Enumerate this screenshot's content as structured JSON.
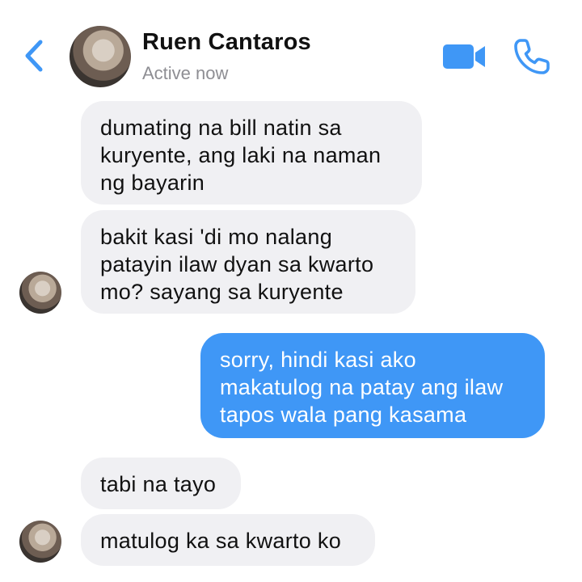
{
  "header": {
    "name": "Ruen Cantaros",
    "status": "Active now",
    "accent": "#3f97f6",
    "icons": [
      "back-chevron-icon",
      "video-call-icon",
      "phone-call-icon"
    ]
  },
  "messages": [
    {
      "sender": "them",
      "text": "dumating na bill natin sa\nkuryente, ang laki na naman\nng bayarin"
    },
    {
      "sender": "them",
      "text": "bakit kasi 'di mo nalang\npatayin ilaw dyan sa kwarto\nmo? sayang sa kuryente"
    },
    {
      "sender": "me",
      "text": "sorry, hindi kasi ako\nmakatulog na patay ang ilaw\ntapos wala pang kasama"
    },
    {
      "sender": "them",
      "text": "tabi na tayo"
    },
    {
      "sender": "them",
      "text": "matulog ka sa kwarto ko"
    }
  ],
  "colors": {
    "incoming_bubble": "#f0f0f3",
    "outgoing_bubble": "#3f97f6"
  }
}
